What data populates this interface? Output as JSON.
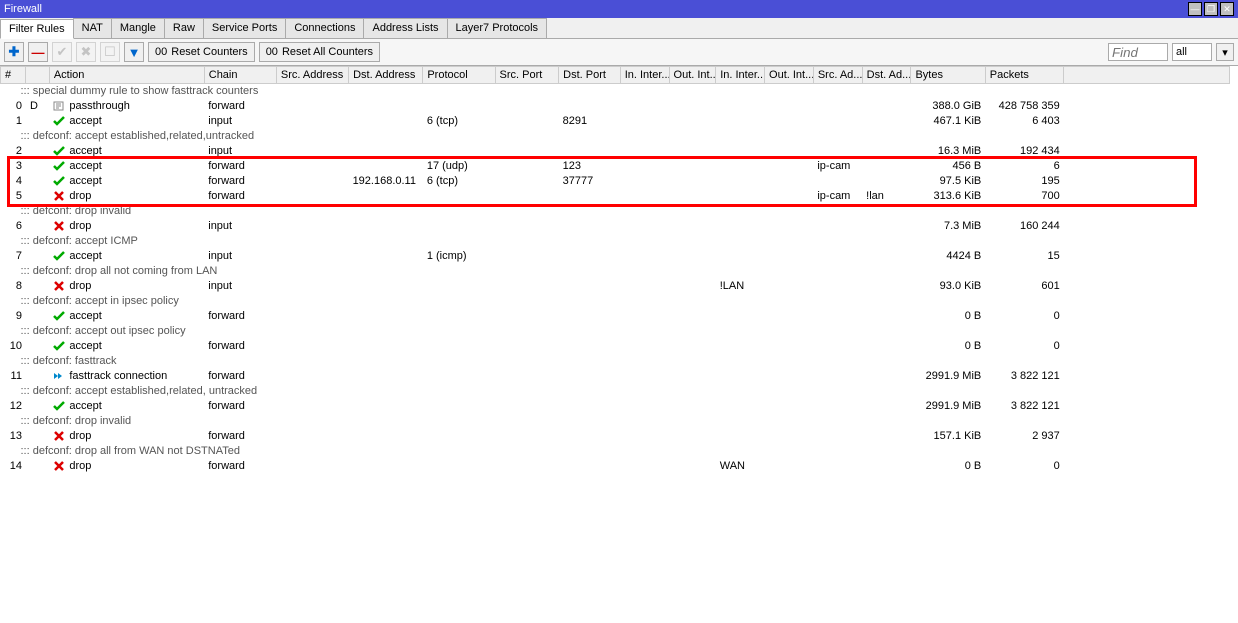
{
  "window": {
    "title": "Firewall"
  },
  "tabs": [
    "Filter Rules",
    "NAT",
    "Mangle",
    "Raw",
    "Service Ports",
    "Connections",
    "Address Lists",
    "Layer7 Protocols"
  ],
  "activeTab": 0,
  "toolbar": {
    "reset_counters": "Reset Counters",
    "reset_all_counters": "Reset All Counters",
    "find_placeholder": "Find",
    "filter_value": "all"
  },
  "columns": [
    "#",
    "",
    "Action",
    "Chain",
    "Src. Address",
    "Dst. Address",
    "Protocol",
    "Src. Port",
    "Dst. Port",
    "In. Inter...",
    "Out. Int...",
    "In. Inter...",
    "Out. Int...",
    "Src. Ad...",
    "Dst. Ad...",
    "Bytes",
    "Packets",
    ""
  ],
  "rows": [
    {
      "type": "comment",
      "text": "::: special dummy rule to show fasttrack counters"
    },
    {
      "num": "0",
      "flag": "D",
      "icon": "passthrough",
      "action": "passthrough",
      "chain": "forward",
      "bytes": "388.0 GiB",
      "packets": "428 758 359"
    },
    {
      "num": "1",
      "icon": "accept",
      "action": "accept",
      "chain": "input",
      "proto": "6 (tcp)",
      "dstport": "8291",
      "bytes": "467.1 KiB",
      "packets": "6 403"
    },
    {
      "type": "comment",
      "text": "::: defconf: accept established,related,untracked"
    },
    {
      "num": "2",
      "icon": "accept",
      "action": "accept",
      "chain": "input",
      "bytes": "16.3 MiB",
      "packets": "192 434"
    },
    {
      "num": "3",
      "icon": "accept",
      "action": "accept",
      "chain": "forward",
      "proto": "17 (udp)",
      "dstport": "123",
      "srclist": "ip-cam",
      "bytes": "456 B",
      "packets": "6",
      "hi": true
    },
    {
      "num": "4",
      "icon": "accept",
      "action": "accept",
      "chain": "forward",
      "dstaddr": "192.168.0.11",
      "proto": "6 (tcp)",
      "dstport": "37777",
      "bytes": "97.5 KiB",
      "packets": "195",
      "hi": true
    },
    {
      "num": "5",
      "icon": "drop",
      "action": "drop",
      "chain": "forward",
      "srclist": "ip-cam",
      "dstlist": "!lan",
      "bytes": "313.6 KiB",
      "packets": "700",
      "hi": true
    },
    {
      "type": "comment",
      "text": "::: defconf: drop invalid"
    },
    {
      "num": "6",
      "icon": "drop",
      "action": "drop",
      "chain": "input",
      "bytes": "7.3 MiB",
      "packets": "160 244"
    },
    {
      "type": "comment",
      "text": "::: defconf: accept ICMP"
    },
    {
      "num": "7",
      "icon": "accept",
      "action": "accept",
      "chain": "input",
      "proto": "1 (icmp)",
      "bytes": "4424 B",
      "packets": "15"
    },
    {
      "type": "comment",
      "text": "::: defconf: drop all not coming from LAN"
    },
    {
      "num": "8",
      "icon": "drop",
      "action": "drop",
      "chain": "input",
      "inifl": "!LAN",
      "bytes": "93.0 KiB",
      "packets": "601"
    },
    {
      "type": "comment",
      "text": "::: defconf: accept in ipsec policy"
    },
    {
      "num": "9",
      "icon": "accept",
      "action": "accept",
      "chain": "forward",
      "bytes": "0 B",
      "packets": "0"
    },
    {
      "type": "comment",
      "text": "::: defconf: accept out ipsec policy"
    },
    {
      "num": "10",
      "icon": "accept",
      "action": "accept",
      "chain": "forward",
      "bytes": "0 B",
      "packets": "0"
    },
    {
      "type": "comment",
      "text": "::: defconf: fasttrack"
    },
    {
      "num": "11",
      "icon": "fasttrack",
      "action": "fasttrack connection",
      "chain": "forward",
      "bytes": "2991.9 MiB",
      "packets": "3 822 121"
    },
    {
      "type": "comment",
      "text": "::: defconf: accept established,related, untracked"
    },
    {
      "num": "12",
      "icon": "accept",
      "action": "accept",
      "chain": "forward",
      "bytes": "2991.9 MiB",
      "packets": "3 822 121"
    },
    {
      "type": "comment",
      "text": "::: defconf: drop invalid"
    },
    {
      "num": "13",
      "icon": "drop",
      "action": "drop",
      "chain": "forward",
      "bytes": "157.1 KiB",
      "packets": "2 937"
    },
    {
      "type": "comment",
      "text": "::: defconf:  drop all from WAN not DSTNATed"
    },
    {
      "num": "14",
      "icon": "drop",
      "action": "drop",
      "chain": "forward",
      "inifl": "WAN",
      "bytes": "0 B",
      "packets": "0"
    }
  ]
}
